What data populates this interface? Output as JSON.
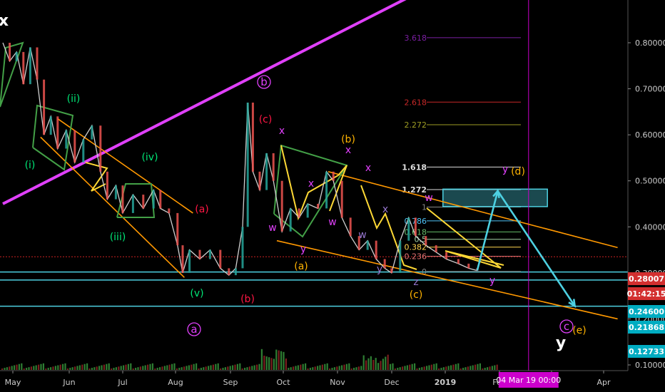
{
  "chart_data": {
    "type": "candlestick",
    "title": "",
    "xlabel": "",
    "ylabel": "",
    "x_ticks": [
      "May",
      "Jun",
      "Jul",
      "Aug",
      "Sep",
      "Oct",
      "Nov",
      "Dec",
      "2019",
      "Feb",
      "Mar",
      "Apr"
    ],
    "y_ticks": [
      "0.10000",
      "0.20000",
      "0.30000",
      "0.40000",
      "0.50000",
      "0.60000",
      "0.70000",
      "0.80000"
    ],
    "ylim": [
      0.085,
      0.87
    ],
    "price_series": {
      "name": "",
      "points": [
        {
          "x": "2018-05-01",
          "y": 0.8
        },
        {
          "x": "2018-05-05",
          "y": 0.76
        },
        {
          "x": "2018-05-09",
          "y": 0.78
        },
        {
          "x": "2018-05-13",
          "y": 0.71
        },
        {
          "x": "2018-05-17",
          "y": 0.79
        },
        {
          "x": "2018-05-21",
          "y": 0.72
        },
        {
          "x": "2018-05-25",
          "y": 0.6
        },
        {
          "x": "2018-05-29",
          "y": 0.64
        },
        {
          "x": "2018-06-02",
          "y": 0.57
        },
        {
          "x": "2018-06-07",
          "y": 0.61
        },
        {
          "x": "2018-06-12",
          "y": 0.54
        },
        {
          "x": "2018-06-17",
          "y": 0.59
        },
        {
          "x": "2018-06-22",
          "y": 0.62
        },
        {
          "x": "2018-06-27",
          "y": 0.52
        },
        {
          "x": "2018-07-01",
          "y": 0.46
        },
        {
          "x": "2018-07-06",
          "y": 0.49
        },
        {
          "x": "2018-07-10",
          "y": 0.43
        },
        {
          "x": "2018-07-16",
          "y": 0.47
        },
        {
          "x": "2018-07-22",
          "y": 0.44
        },
        {
          "x": "2018-07-28",
          "y": 0.48
        },
        {
          "x": "2018-08-01",
          "y": 0.44
        },
        {
          "x": "2018-08-06",
          "y": 0.43
        },
        {
          "x": "2018-08-11",
          "y": 0.36
        },
        {
          "x": "2018-08-14",
          "y": 0.3
        },
        {
          "x": "2018-08-18",
          "y": 0.35
        },
        {
          "x": "2018-08-24",
          "y": 0.33
        },
        {
          "x": "2018-08-30",
          "y": 0.35
        },
        {
          "x": "2018-09-05",
          "y": 0.31
        },
        {
          "x": "2018-09-10",
          "y": 0.295
        },
        {
          "x": "2018-09-14",
          "y": 0.31
        },
        {
          "x": "2018-09-18",
          "y": 0.4
        },
        {
          "x": "2018-09-21",
          "y": 0.67
        },
        {
          "x": "2018-09-24",
          "y": 0.52
        },
        {
          "x": "2018-09-28",
          "y": 0.48
        },
        {
          "x": "2018-10-02",
          "y": 0.56
        },
        {
          "x": "2018-10-06",
          "y": 0.5
        },
        {
          "x": "2018-10-11",
          "y": 0.39
        },
        {
          "x": "2018-10-16",
          "y": 0.44
        },
        {
          "x": "2018-10-21",
          "y": 0.42
        },
        {
          "x": "2018-10-26",
          "y": 0.45
        },
        {
          "x": "2018-11-01",
          "y": 0.44
        },
        {
          "x": "2018-11-06",
          "y": 0.52
        },
        {
          "x": "2018-11-10",
          "y": 0.5
        },
        {
          "x": "2018-11-15",
          "y": 0.42
        },
        {
          "x": "2018-11-20",
          "y": 0.38
        },
        {
          "x": "2018-11-25",
          "y": 0.35
        },
        {
          "x": "2018-11-30",
          "y": 0.37
        },
        {
          "x": "2018-12-05",
          "y": 0.33
        },
        {
          "x": "2018-12-10",
          "y": 0.31
        },
        {
          "x": "2018-12-14",
          "y": 0.3
        },
        {
          "x": "2018-12-19",
          "y": 0.37
        },
        {
          "x": "2018-12-24",
          "y": 0.42
        },
        {
          "x": "2018-12-28",
          "y": 0.38
        },
        {
          "x": "2019-01-03",
          "y": 0.36
        },
        {
          "x": "2019-01-09",
          "y": 0.345
        },
        {
          "x": "2019-01-15",
          "y": 0.33
        },
        {
          "x": "2019-01-22",
          "y": 0.32
        },
        {
          "x": "2019-01-28",
          "y": 0.31
        },
        {
          "x": "2019-02-02",
          "y": 0.305
        }
      ]
    },
    "horizontal_lines": [
      {
        "value": 0.335,
        "color": "#cc2222",
        "style": "dashed"
      },
      {
        "value": 0.302,
        "color": "#4dd0e1",
        "style": "solid"
      },
      {
        "value": 0.2845,
        "color": "#4dd0e1",
        "style": "solid"
      },
      {
        "value": 0.2275,
        "color": "#4dd0e1",
        "style": "solid"
      }
    ],
    "vertical_marker": {
      "x": "2019-03-04",
      "color": "#cc00cc",
      "label": "04 Mar 19  00:00"
    },
    "fib_levels": [
      {
        "label": "3.618",
        "value": 0.811,
        "color": "#7b1fa2"
      },
      {
        "label": "2.618",
        "value": 0.671,
        "color": "#c62828"
      },
      {
        "label": "2.272",
        "value": 0.622,
        "color": "#9e9d24"
      },
      {
        "label": "1.618",
        "value": 0.53,
        "color": "#dddddd"
      },
      {
        "label": "1.272",
        "value": 0.481,
        "color": "#dddddd"
      },
      {
        "label": "1",
        "value": 0.443,
        "color": "#888888"
      },
      {
        "label": "0.786",
        "value": 0.413,
        "color": "#4fc3f7"
      },
      {
        "label": "0.618",
        "value": 0.389,
        "color": "#66bb6a"
      },
      {
        "label": "0.5",
        "value": 0.373,
        "color": "#a5d6a7"
      },
      {
        "label": "0.382",
        "value": 0.356,
        "color": "#ffd54f"
      },
      {
        "label": "0.236",
        "value": 0.336,
        "color": "#e57373"
      },
      {
        "label": "0",
        "value": 0.303,
        "color": "#888888"
      }
    ],
    "target_box": {
      "x_start": "2019-01-13",
      "x_end": "2019-03-15",
      "y_low": 0.444,
      "y_high": 0.482,
      "color": "#4dd0e1"
    },
    "trend_lines": [
      {
        "color": "#e040fb",
        "points": [
          {
            "x": "2018-05-01",
            "y": 0.45
          },
          {
            "x": "2019-01-20",
            "y": 0.95
          }
        ]
      },
      {
        "color": "#ff9800",
        "points": [
          {
            "x": "2018-06-02",
            "y": 0.635
          },
          {
            "x": "2018-08-20",
            "y": 0.43
          }
        ]
      },
      {
        "color": "#ff9800",
        "points": [
          {
            "x": "2018-05-23",
            "y": 0.595
          },
          {
            "x": "2018-08-15",
            "y": 0.29
          }
        ]
      },
      {
        "color": "#ff9800",
        "points": [
          {
            "x": "2018-11-07",
            "y": 0.52
          },
          {
            "x": "2019-04-25",
            "y": 0.355
          }
        ]
      },
      {
        "color": "#ff9800",
        "points": [
          {
            "x": "2018-10-08",
            "y": 0.37
          },
          {
            "x": "2019-04-25",
            "y": 0.2
          }
        ]
      }
    ],
    "projection": {
      "color": "#4dd0e1",
      "points": [
        {
          "x": "2019-02-02",
          "y": 0.305
        },
        {
          "x": "2019-02-14",
          "y": 0.478
        },
        {
          "x": "2019-03-31",
          "y": 0.228
        }
      ]
    },
    "wave_labels": [
      {
        "text": "x",
        "color": "#ffffff"
      },
      {
        "text": "(i)",
        "color": "#00e676"
      },
      {
        "text": "(ii)",
        "color": "#00e676"
      },
      {
        "text": "(iii)",
        "color": "#00e676"
      },
      {
        "text": "(iv)",
        "color": "#00e676"
      },
      {
        "text": "(v)",
        "color": "#00e676"
      },
      {
        "text": "(a)",
        "color": "#ff1744"
      },
      {
        "text": "(b)",
        "color": "#ff1744"
      },
      {
        "text": "(c)",
        "color": "#ff1744"
      },
      {
        "text": "a",
        "color": "#e040fb"
      },
      {
        "text": "b",
        "color": "#e040fb"
      },
      {
        "text": "c",
        "color": "#e040fb"
      },
      {
        "text": "x",
        "color": "#e040fb"
      },
      {
        "text": "w",
        "color": "#e040fb"
      },
      {
        "text": "y",
        "color": "#e040fb"
      },
      {
        "text": "x",
        "color": "#e040fb"
      },
      {
        "text": "w",
        "color": "#e040fb"
      },
      {
        "text": "x",
        "color": "#e040fb"
      },
      {
        "text": "y",
        "color": "#e040fb"
      },
      {
        "text": "y",
        "color": "#e040fb"
      },
      {
        "text": "x",
        "color": "#e040fb"
      },
      {
        "text": "w",
        "color": "#e040fb"
      },
      {
        "text": "w",
        "color": "#9575cd"
      },
      {
        "text": "x",
        "color": "#9575cd"
      },
      {
        "text": "y",
        "color": "#9575cd"
      },
      {
        "text": "z",
        "color": "#9575cd"
      },
      {
        "text": "(a)",
        "color": "#ffb300"
      },
      {
        "text": "(b)",
        "color": "#ffb300"
      },
      {
        "text": "(c)",
        "color": "#ffb300"
      },
      {
        "text": "(d)",
        "color": "#ffb300"
      },
      {
        "text": "(e)",
        "color": "#ffb300"
      },
      {
        "text": "y",
        "color": "#ffffff"
      }
    ],
    "price_badges": [
      {
        "text": "0.28007",
        "color": "#d32f2f"
      },
      {
        "text": "01:42:15",
        "color": "#d32f2f"
      },
      {
        "text": "0.24600",
        "color": "#00acc1"
      },
      {
        "text": "0.21868",
        "color": "#00acc1"
      },
      {
        "text": "0.12733",
        "color": "#00acc1"
      }
    ],
    "legend": "none",
    "grid": false
  }
}
